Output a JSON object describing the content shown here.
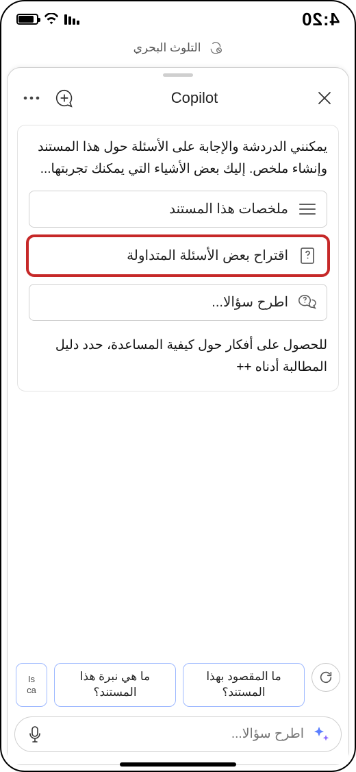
{
  "status": {
    "time": "4:20"
  },
  "doc": {
    "title": "التلوث البحري"
  },
  "copilot": {
    "title": "Copilot",
    "intro": "يمكنني الدردشة والإجابة على الأسئلة حول هذا المستند وإنشاء ملخص. إليك بعض الأشياء التي يمكنك تجربتها...",
    "options": {
      "summarize": "ملخصات هذا المستند",
      "faq": "اقتراح بعض الأسئلة المتداولة",
      "ask": "اطرح سؤالا..."
    },
    "footer": "للحصول على أفكار حول كيفية المساعدة، حدد دليل المطالبة أدناه ++"
  },
  "suggestions": {
    "partial_top": "Is",
    "partial_bottom": "ca",
    "pill1": "ما هي نبرة هذا المستند؟",
    "pill2": "ما المقصود بهذا المستند؟"
  },
  "input": {
    "placeholder": "اطرح سؤالا..."
  }
}
